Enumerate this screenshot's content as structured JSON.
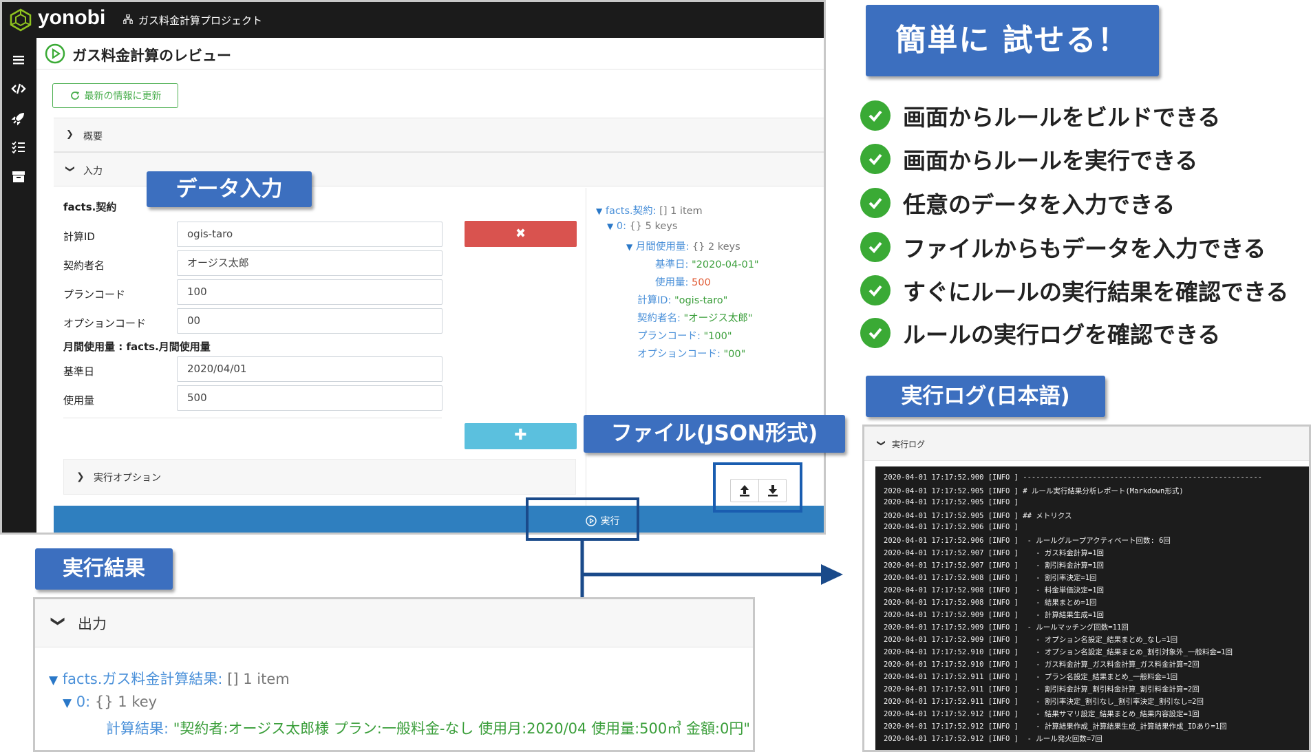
{
  "app": {
    "brand": "yonobi",
    "project": "ガス料金計算プロジェクト",
    "page_title": "ガス料金計算のレビュー",
    "refresh_label": "最新の情報に更新",
    "accordion_summary": "概要",
    "accordion_input": "入力",
    "exec_options": "実行オプション",
    "run_label": "実行",
    "delete_symbol": "✖",
    "add_symbol": "✚"
  },
  "form": {
    "section_label": "facts.契約",
    "monthly_label": "月間使用量 : facts.月間使用量",
    "fields": [
      {
        "label": "計算ID",
        "value": "ogis-taro"
      },
      {
        "label": "契約者名",
        "value": "オージス太郎"
      },
      {
        "label": "プランコード",
        "value": "100"
      },
      {
        "label": "オプションコード",
        "value": "00"
      }
    ],
    "monthly_fields": [
      {
        "label": "基準日",
        "value": "2020/04/01"
      },
      {
        "label": "使用量",
        "value": "500"
      }
    ]
  },
  "json_view": {
    "root_key": "facts.契約:",
    "root_meta": "[]  1 item",
    "item_key": "0:",
    "item_meta": "{}  5 keys",
    "monthly_key": "月間使用量:",
    "monthly_meta": "{}  2 keys",
    "date_key": "基準日:",
    "date_value": "\"2020-04-01\"",
    "usage_key": "使用量:",
    "usage_value": "500",
    "calc_id_key": "計算ID:",
    "calc_id_value": "\"ogis-taro\"",
    "name_key": "契約者名:",
    "name_value": "\"オージス太郎\"",
    "plan_key": "プランコード:",
    "plan_value": "\"100\"",
    "option_key": "オプションコード:",
    "option_value": "\"00\""
  },
  "callouts": {
    "data_input": "データ入力",
    "file_json": "ファイル(JSON形式)",
    "result": "実行結果",
    "easy": "簡単に 試せる！",
    "log_ja": "実行ログ(日本語)"
  },
  "features": [
    "画面からルールをビルドできる",
    "画面からルールを実行できる",
    "任意のデータを入力できる",
    "ファイルからもデータを入力できる",
    "すぐにルールの実行結果を確認できる",
    "ルールの実行ログを確認できる"
  ],
  "output": {
    "header": "出力",
    "root_key": "facts.ガス料金計算結果:",
    "root_meta": "[]  1 item",
    "item_key": "0:",
    "item_meta": "{}  1 key",
    "result_key": "計算結果:",
    "result_value": "\"契約者:オージス太郎様 プラン:一般料金-なし 使用月:2020/04 使用量:500㎥ 金額:0円\""
  },
  "log": {
    "header": "実行ログ",
    "lines": [
      "2020-04-01 17:17:52.900 [INFO ] -------------------------------------------------------",
      "2020-04-01 17:17:52.905 [INFO ] # ルール実行結果分析レポート(Markdown形式)",
      "2020-04-01 17:17:52.905 [INFO ]",
      "2020-04-01 17:17:52.905 [INFO ] ## メトリクス",
      "2020-04-01 17:17:52.906 [INFO ]",
      "2020-04-01 17:17:52.906 [INFO ]  - ルールグループアクティベート回数: 6回",
      "2020-04-01 17:17:52.907 [INFO ]    - ガス料金計算=1回",
      "2020-04-01 17:17:52.907 [INFO ]    - 割引料金計算=1回",
      "2020-04-01 17:17:52.908 [INFO ]    - 割引率決定=1回",
      "2020-04-01 17:17:52.908 [INFO ]    - 料金単価決定=1回",
      "2020-04-01 17:17:52.908 [INFO ]    - 結果まとめ=1回",
      "2020-04-01 17:17:52.909 [INFO ]    - 計算結果生成=1回",
      "2020-04-01 17:17:52.909 [INFO ]  - ルールマッチング回数=11回",
      "2020-04-01 17:17:52.909 [INFO ]    - オプション名設定_結果まとめ_なし=1回",
      "2020-04-01 17:17:52.910 [INFO ]    - オプション名設定_結果まとめ_割引対象外_一般料金=1回",
      "2020-04-01 17:17:52.910 [INFO ]    - ガス料金計算_ガス料金計算_ガス料金計算=2回",
      "2020-04-01 17:17:52.911 [INFO ]    - プラン名設定_結果まとめ_一般料金=1回",
      "2020-04-01 17:17:52.911 [INFO ]    - 割引料金計算_割引料金計算_割引料金計算=2回",
      "2020-04-01 17:17:52.911 [INFO ]    - 割引率決定_割引なし_割引率決定_割引なし=2回",
      "2020-04-01 17:17:52.912 [INFO ]    - 結果サマリ設定_結果まとめ_結果内容設定=1回",
      "2020-04-01 17:17:52.912 [INFO ]    - 計算結果作成_計算結果生成_計算結果作成_IDあり=1回",
      "2020-04-01 17:17:52.912 [INFO ]  - ルール発火回数=7回"
    ]
  },
  "colors": {
    "topbar": "#1b1b1b",
    "accent_green": "#3aaa35",
    "callout_blue": "#3c6fbf",
    "run_bar": "#2f7fbf",
    "delete_red": "#d9534f",
    "add_cyan": "#5bc0de",
    "arrow_blue": "#1a4a8a"
  }
}
